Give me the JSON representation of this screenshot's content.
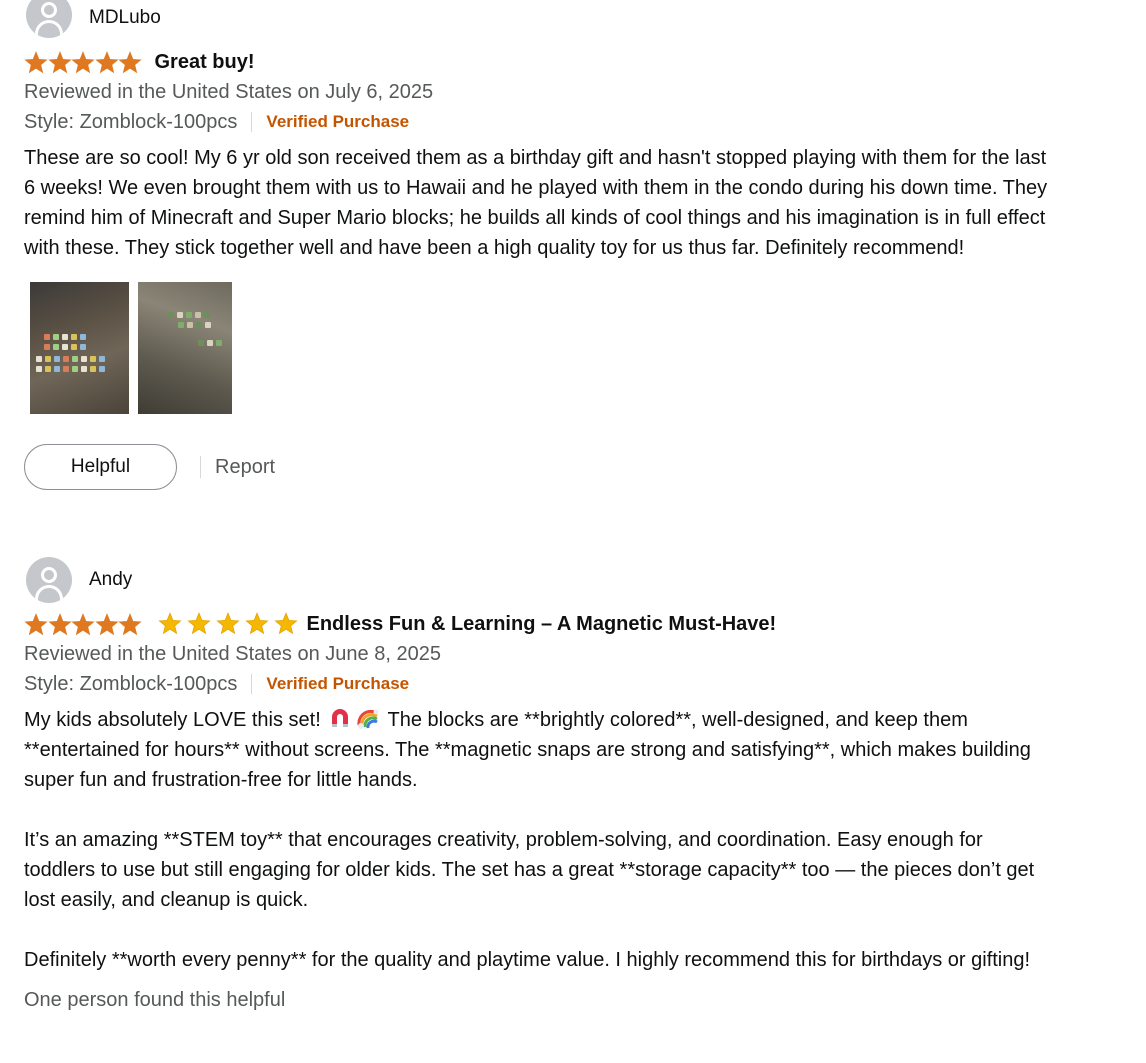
{
  "reviews": [
    {
      "author": "MDLubo",
      "rating": 5,
      "rating_max": 5,
      "title": "Great buy!",
      "date_text": "Reviewed in the United States on July 6, 2025",
      "style_text": "Style: Zomblock-100pcs",
      "verified_text": "Verified Purchase",
      "body": [
        "These are so cool! My 6 yr old son received them as a birthday gift and hasn't stopped playing with them for the last 6 weeks! We even brought them with us to Hawaii and he played with them in the condo during his down time. They remind him of Minecraft and Super Mario blocks; he builds all kinds of cool things and his imagination is in full effect with these. They stick together well and have been a high quality toy for us thus far. Definitely recommend!"
      ],
      "photos": [
        "customer-photo-1",
        "customer-photo-2"
      ],
      "helpful_label": "Helpful",
      "report_label": "Report"
    },
    {
      "author": "Andy",
      "rating": 5,
      "rating_max": 5,
      "title_emoji_stars": 5,
      "title": "Endless Fun & Learning – A Magnetic Must-Have!",
      "date_text": "Reviewed in the United States on June 8, 2025",
      "style_text": "Style: Zomblock-100pcs",
      "verified_text": "Verified Purchase",
      "body_p1_before": "My kids absolutely LOVE this set! ",
      "body_p1_after": " The blocks are **brightly colored**, well-designed, and keep them **entertained for hours** without screens. The **magnetic snaps are strong and satisfying**, which makes building super fun and frustration-free for little hands.",
      "body_p2": "It’s an amazing **STEM toy** that encourages creativity, problem-solving, and coordination. Easy enough for toddlers to use but still engaging for older kids. The set has a great **storage capacity** too — the pieces don’t get lost easily, and cleanup is quick.",
      "body_p3": "Definitely **worth every penny** for the quality and playtime value. I highly recommend this for birthdays or gifting!",
      "body_emojis": [
        "magnet-emoji",
        "rainbow-emoji"
      ],
      "helpful_count_text": "One person found this helpful"
    }
  ],
  "colors": {
    "star_orange": "#de7921",
    "verified_orange": "#c45500",
    "secondary_text": "#565959",
    "primary_text": "#0f1111",
    "emoji_star_gold": "#f5b800"
  }
}
